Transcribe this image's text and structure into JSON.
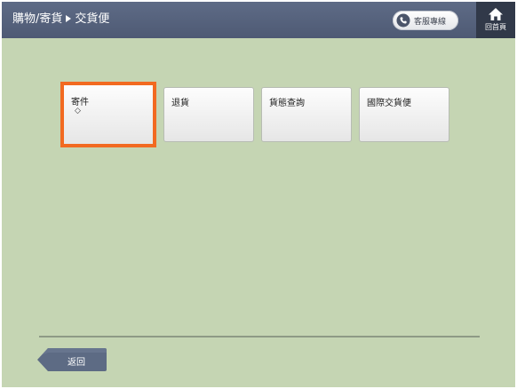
{
  "header": {
    "breadcrumb_parent": "購物/寄貨",
    "breadcrumb_current": "交貨便",
    "service_label": "客服專線",
    "home_label": "回首頁"
  },
  "tiles": [
    {
      "label": "寄件",
      "sub": "◇",
      "selected": true
    },
    {
      "label": "退貨"
    },
    {
      "label": "貨態查詢"
    },
    {
      "label": "國際交貨便"
    }
  ],
  "footer": {
    "back_label": "返回"
  },
  "colors": {
    "header_bg": "#55627d",
    "home_bg": "#313949",
    "background": "#c5d5b3",
    "highlight": "#f26a21",
    "back_button": "#5d6b84"
  },
  "icons": {
    "phone": "phone-icon",
    "home": "home-icon",
    "breadcrumb_separator": "triangle-right-icon",
    "back": "back-arrow-icon"
  }
}
